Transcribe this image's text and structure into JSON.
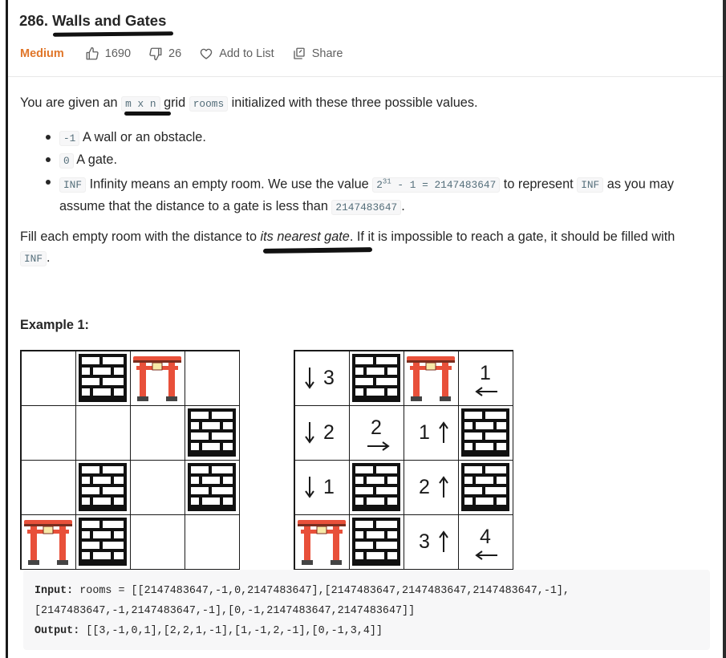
{
  "problem": {
    "title_prefix": "286. ",
    "title_name": "Walls and Gates",
    "difficulty": "Medium",
    "likes": "1690",
    "dislikes": "26",
    "add_to_list": "Add to List",
    "share": "Share"
  },
  "description": {
    "p1_a": "You are given an ",
    "p1_code1": "m x n",
    "p1_b": " grid ",
    "p1_code2": "rooms",
    "p1_c": " initialized with these three possible values.",
    "bullets": [
      {
        "code": "-1",
        "text": " A wall or an obstacle."
      },
      {
        "code": "0",
        "text": " A gate."
      },
      {
        "code": "INF",
        "text_a": " Infinity means an empty room. We use the value ",
        "code2": "2",
        "sup": "31",
        "code3": " - 1 = 2147483647",
        "text_b": " to represent ",
        "code4": "INF",
        "text_c": " as you may assume that the distance to a gate is less than ",
        "code5": "2147483647",
        "text_d": "."
      }
    ],
    "p2_a": "Fill each empty room with the distance to ",
    "p2_em": "its nearest gate",
    "p2_b": ". If it is impossible to reach a gate, it should be filled with ",
    "p2_code": "INF",
    "p2_c": "."
  },
  "example": {
    "title": "Example 1:",
    "input_label": "Input:",
    "input_line1": " rooms = [[2147483647,-1,0,2147483647],[2147483647,2147483647,2147483647,-1],",
    "input_line2": "[2147483647,-1,2147483647,-1],[0,-1,2147483647,2147483647]]",
    "output_label": "Output:",
    "output_value": " [[3,-1,0,1],[2,2,1,-1],[1,-1,2,-1],[0,-1,3,4]]"
  },
  "grid_left": [
    [
      "empty",
      "wall",
      "gate",
      "empty"
    ],
    [
      "empty",
      "empty",
      "empty",
      "wall"
    ],
    [
      "empty",
      "wall",
      "empty",
      "wall"
    ],
    [
      "gate",
      "wall",
      "empty",
      "empty"
    ]
  ],
  "grid_right": [
    [
      {
        "t": "num",
        "v": "3",
        "arrow": "down-left"
      },
      {
        "t": "wall"
      },
      {
        "t": "gate"
      },
      {
        "t": "num",
        "v": "1",
        "arrow": "under-left"
      }
    ],
    [
      {
        "t": "num",
        "v": "2",
        "arrow": "down-left"
      },
      {
        "t": "num",
        "v": "2",
        "arrow": "under-right"
      },
      {
        "t": "num",
        "v": "1",
        "arrow": "up-right"
      },
      {
        "t": "wall"
      }
    ],
    [
      {
        "t": "num",
        "v": "1",
        "arrow": "down-left"
      },
      {
        "t": "wall"
      },
      {
        "t": "num",
        "v": "2",
        "arrow": "up-right"
      },
      {
        "t": "wall"
      }
    ],
    [
      {
        "t": "gate"
      },
      {
        "t": "wall"
      },
      {
        "t": "num",
        "v": "3",
        "arrow": "up-right"
      },
      {
        "t": "num",
        "v": "4",
        "arrow": "under-left"
      }
    ]
  ],
  "colors": {
    "difficulty": "#e0762a",
    "gate": "#e8503a",
    "wall": "#111111"
  },
  "icons": [
    "thumbs-up-icon",
    "thumbs-down-icon",
    "heart-icon",
    "share-icon",
    "wall-icon",
    "gate-icon"
  ]
}
